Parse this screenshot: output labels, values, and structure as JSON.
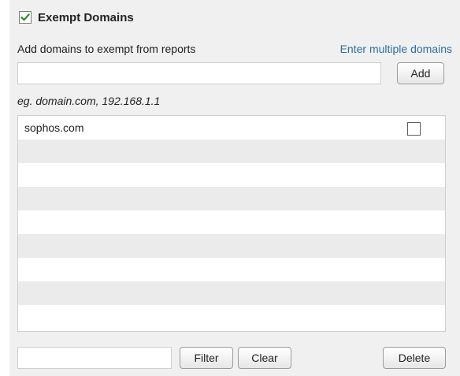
{
  "section": {
    "title": "Exempt Domains",
    "enabled": true
  },
  "add_form": {
    "label": "Add domains to exempt from reports",
    "multiple_link": "Enter multiple domains",
    "input_value": "",
    "input_placeholder": "",
    "add_button": "Add",
    "hint": "eg. domain.com, 192.168.1.1"
  },
  "domain_list": {
    "items": [
      {
        "domain": "sophos.com",
        "selected": false
      },
      {
        "domain": "",
        "selected": null
      },
      {
        "domain": "",
        "selected": null
      },
      {
        "domain": "",
        "selected": null
      },
      {
        "domain": "",
        "selected": null
      },
      {
        "domain": "",
        "selected": null
      },
      {
        "domain": "",
        "selected": null
      },
      {
        "domain": "",
        "selected": null
      },
      {
        "domain": "",
        "selected": null
      }
    ]
  },
  "footer": {
    "filter_value": "",
    "filter_button": "Filter",
    "clear_button": "Clear",
    "delete_button": "Delete"
  },
  "colors": {
    "panel_background": "#f0f0f0",
    "link": "#2f6ea5",
    "checkmark": "#2e8b2e",
    "row_alt": "#ebebeb"
  }
}
